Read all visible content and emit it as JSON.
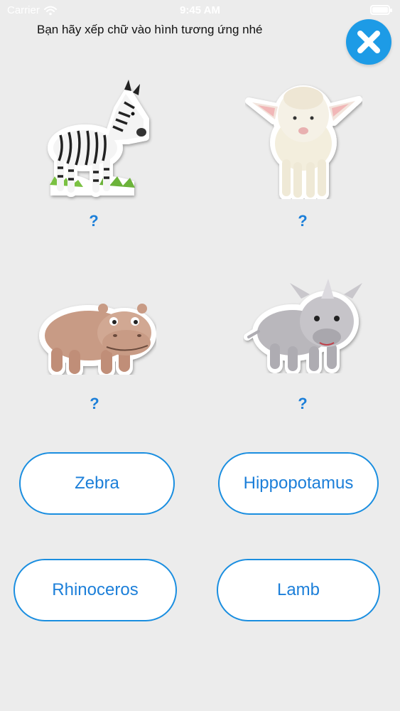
{
  "status": {
    "carrier": "Carrier",
    "time": "9:45 AM",
    "battery_level": 1.0
  },
  "instruction": "Bạn hãy xếp chữ vào hình tương ứng nhé",
  "colors": {
    "accent": "#1d9be6",
    "text_blue": "#1c7fd9",
    "background": "#ececec"
  },
  "animals": [
    {
      "name": "zebra",
      "answer": "?"
    },
    {
      "name": "lamb",
      "answer": "?"
    },
    {
      "name": "hippopotamus",
      "answer": "?"
    },
    {
      "name": "rhinoceros",
      "answer": "?"
    }
  ],
  "options": [
    "Zebra",
    "Hippopotamus",
    "Rhinoceros",
    "Lamb"
  ]
}
